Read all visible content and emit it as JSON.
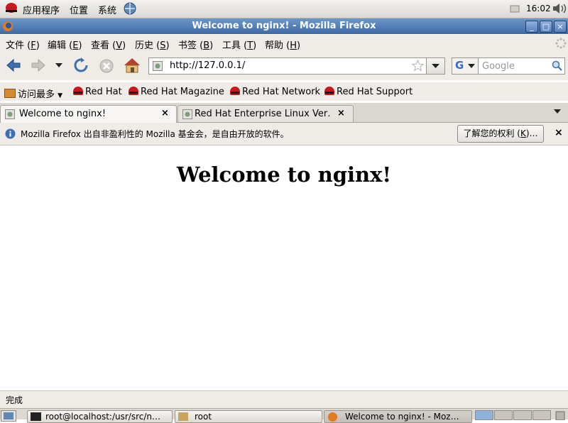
{
  "top_panel": {
    "menus": [
      "应用程序",
      "位置",
      "系统"
    ],
    "clock": "16:02"
  },
  "window": {
    "title": "Welcome to nginx! - Mozilla Firefox",
    "buttons": [
      "_",
      "□",
      "×"
    ]
  },
  "menubar": {
    "items": [
      {
        "label": "文件 (",
        "key": "F",
        "end": ")"
      },
      {
        "label": "编辑 (",
        "key": "E",
        "end": ")"
      },
      {
        "label": "查看 (",
        "key": "V",
        "end": ")"
      },
      {
        "label": "历史 (",
        "key": "S",
        "end": ")"
      },
      {
        "label": "书签 (",
        "key": "B",
        "end": ")"
      },
      {
        "label": "工具 (",
        "key": "T",
        "end": ")"
      },
      {
        "label": "帮助 (",
        "key": "H",
        "end": ")"
      }
    ]
  },
  "navbar": {
    "url": "http://127.0.0.1/",
    "search_placeholder": "Google",
    "search_engine_letter": "G"
  },
  "bookmarks": {
    "most_visited": "访问最多",
    "items": [
      "Red Hat",
      "Red Hat Magazine",
      "Red Hat Network",
      "Red Hat Support"
    ]
  },
  "tabs": [
    {
      "label": "Welcome to nginx!",
      "active": true
    },
    {
      "label": "Red Hat Enterprise Linux Ver…",
      "active": false
    }
  ],
  "infobar": {
    "message": "Mozilla Firefox 出自非盈利性的 Mozilla 基金会，是自由开放的软件。",
    "button_label": "了解您的权利 (",
    "button_key": "K",
    "button_end": ")…"
  },
  "content": {
    "heading": "Welcome to nginx!"
  },
  "statusbar": {
    "text": "完成"
  },
  "taskbar": {
    "tasks": [
      "root@localhost:/usr/src/n…",
      "root",
      "Welcome to nginx! - Moz…"
    ]
  },
  "colors": {
    "titlebar": "#3e6aa5",
    "redhat_red": "#c8171f",
    "chrome_bg": "#efebe7"
  }
}
